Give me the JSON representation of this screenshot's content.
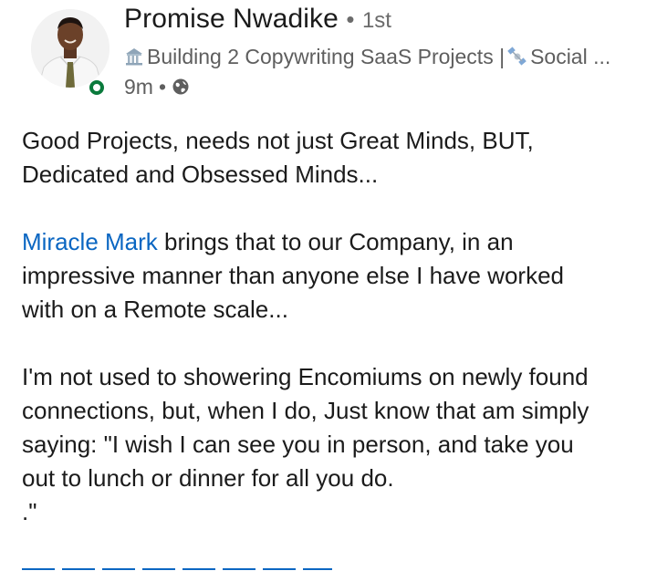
{
  "post": {
    "author": {
      "name": "Promise Nwadike",
      "separator": "•",
      "degree": "1st",
      "headline_emoji_1": "bank-emoji-icon",
      "headline_text": "Building 2 Copywriting SaaS Projects |",
      "headline_emoji_2": "satellite-emoji-icon",
      "headline_tail": "Social ...",
      "avatar": "profile-photo",
      "online": true
    },
    "time": "9m",
    "time_separator": "•",
    "visibility_icon": "globe-icon",
    "body": {
      "p1_line1": "Good Projects, needs not just Great Minds, BUT,",
      "p1_line2": "Dedicated and Obsessed Minds...",
      "mention": "Miracle Mark",
      "p2_rest_line1": " brings that to our Company, in an",
      "p2_line2": "impressive manner than anyone else I have worked",
      "p2_line3": "with on a Remote scale...",
      "p3_line1": "I'm not used to showering Encomiums on newly found",
      "p3_line2": "connections, but, when I do, Just know that am simply",
      "p3_line3": "saying: \"I wish I can see you in person, and take you",
      "p3_line4": "out to lunch or dinner for all you do.",
      "p3_line5": ".\""
    }
  },
  "colors": {
    "link": "#0a66c2",
    "online": "#0a7a3c",
    "muted": "#5e5e5e",
    "text": "#1b1b1b"
  }
}
